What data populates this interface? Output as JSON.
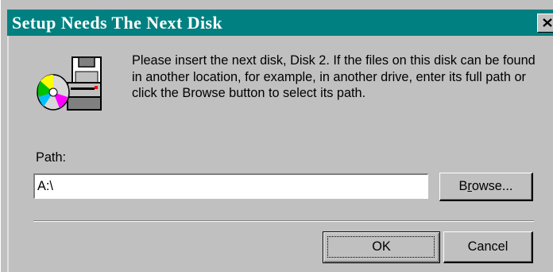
{
  "dialog": {
    "title": "Setup Needs The Next Disk",
    "message": "Please insert the next disk, Disk 2. If the files on this disk can be found in another location, for example, in another drive, enter its full path or click the Browse button to select its path.",
    "path_label": "Path:",
    "path_value": "A:\\",
    "browse_label_pre": "B",
    "browse_label_underlined": "r",
    "browse_label_post": "owse...",
    "ok_label": "OK",
    "cancel_label": "Cancel",
    "icon": "setup-disk-icon",
    "close_icon": "close-icon"
  },
  "colors": {
    "titlebar": "#008080",
    "face": "#c0c0c0"
  }
}
